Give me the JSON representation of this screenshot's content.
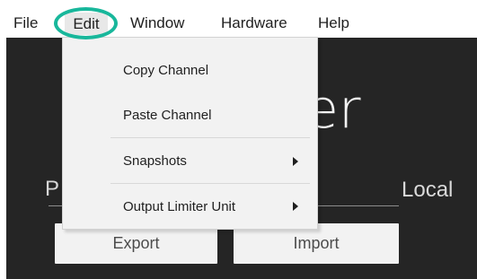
{
  "menubar": {
    "items": [
      "File",
      "Edit",
      "Window",
      "Hardware",
      "Help"
    ]
  },
  "dropdown": {
    "items": [
      {
        "label": "Copy Channel"
      },
      {
        "label": "Paste Channel"
      },
      {
        "label": "Snapshots",
        "has_submenu": true
      },
      {
        "label": "Output Limiter Unit",
        "has_submenu": true
      }
    ]
  },
  "background": {
    "product_text": "er",
    "left_tab_text": "P",
    "right_tab_text": "Local",
    "buttons": [
      "Export",
      "Import"
    ]
  },
  "icons": {
    "submenu_arrow": "chevron-right-icon"
  },
  "colors": {
    "highlight_ring": "#18b79b",
    "app_background": "#252525",
    "menu_background": "#f2f2f2"
  }
}
